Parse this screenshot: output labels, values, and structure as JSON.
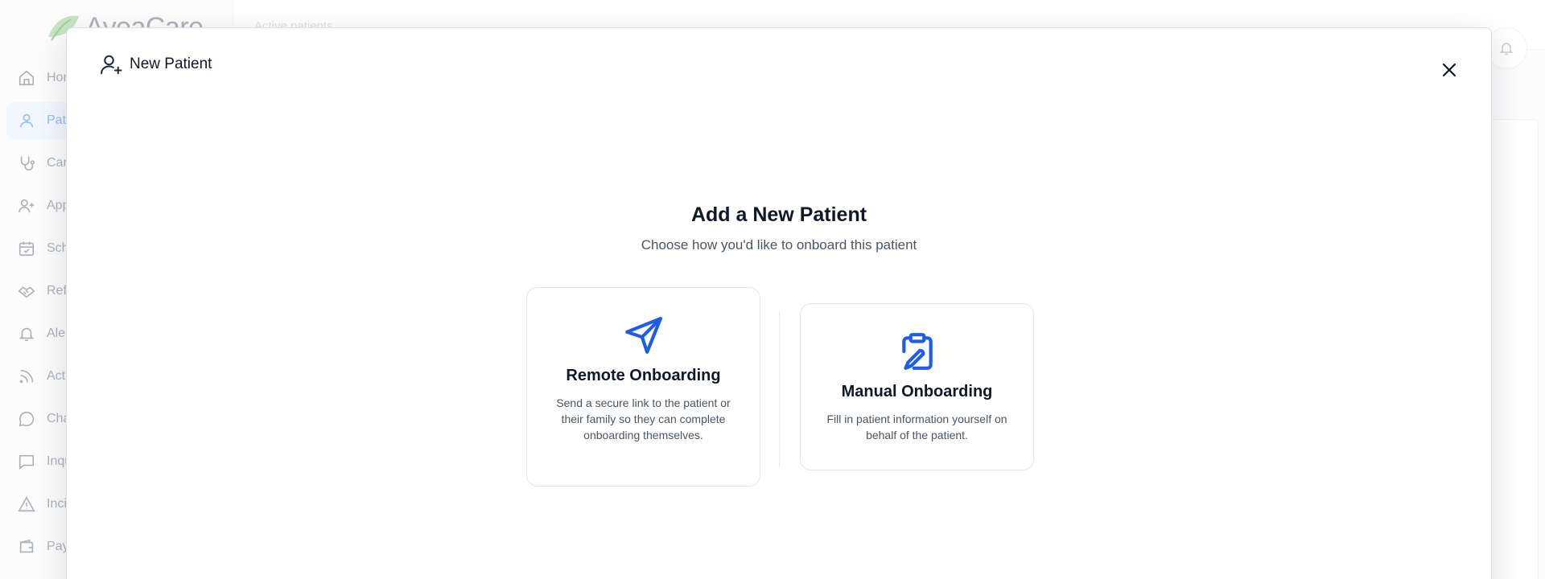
{
  "app": {
    "logo_text": "AyeaCare",
    "header_crumb": "Active patients",
    "nav": [
      {
        "label": "Home",
        "icon": "home-icon",
        "active": false
      },
      {
        "label": "Patients",
        "icon": "user-icon",
        "active": true
      },
      {
        "label": "Care",
        "icon": "stethoscope-icon",
        "active": false
      },
      {
        "label": "Applicants",
        "icon": "user-plus-icon",
        "active": false
      },
      {
        "label": "Schedule",
        "icon": "calendar-check-icon",
        "active": false
      },
      {
        "label": "Referrals",
        "icon": "handshake-icon",
        "active": false
      },
      {
        "label": "Alerts",
        "icon": "bell-icon",
        "active": false
      },
      {
        "label": "Activity",
        "icon": "rss-icon",
        "active": false
      },
      {
        "label": "Chat",
        "icon": "chat-bubble-icon",
        "active": false
      },
      {
        "label": "Inquiries",
        "icon": "message-square-icon",
        "active": false
      },
      {
        "label": "Incidents",
        "icon": "alert-triangle-icon",
        "active": false
      },
      {
        "label": "Payments",
        "icon": "wallet-icon",
        "active": false
      }
    ]
  },
  "modal": {
    "title": "New Patient",
    "heading": "Add a New Patient",
    "subheading": "Choose how you'd like to onboard this patient",
    "options": [
      {
        "title": "Remote Onboarding",
        "description": "Send a secure link to the patient or their family so they can complete onboarding themselves.",
        "icon": "send-icon"
      },
      {
        "title": "Manual Onboarding",
        "description": "Fill in patient information yourself on behalf of the patient.",
        "icon": "clipboard-pen-icon"
      }
    ]
  },
  "colors": {
    "accent": "#1d5be8",
    "active_nav_bg": "#eaf2fe",
    "active_nav_text": "#3b82f6",
    "logo_leaf": "#7cc576"
  }
}
